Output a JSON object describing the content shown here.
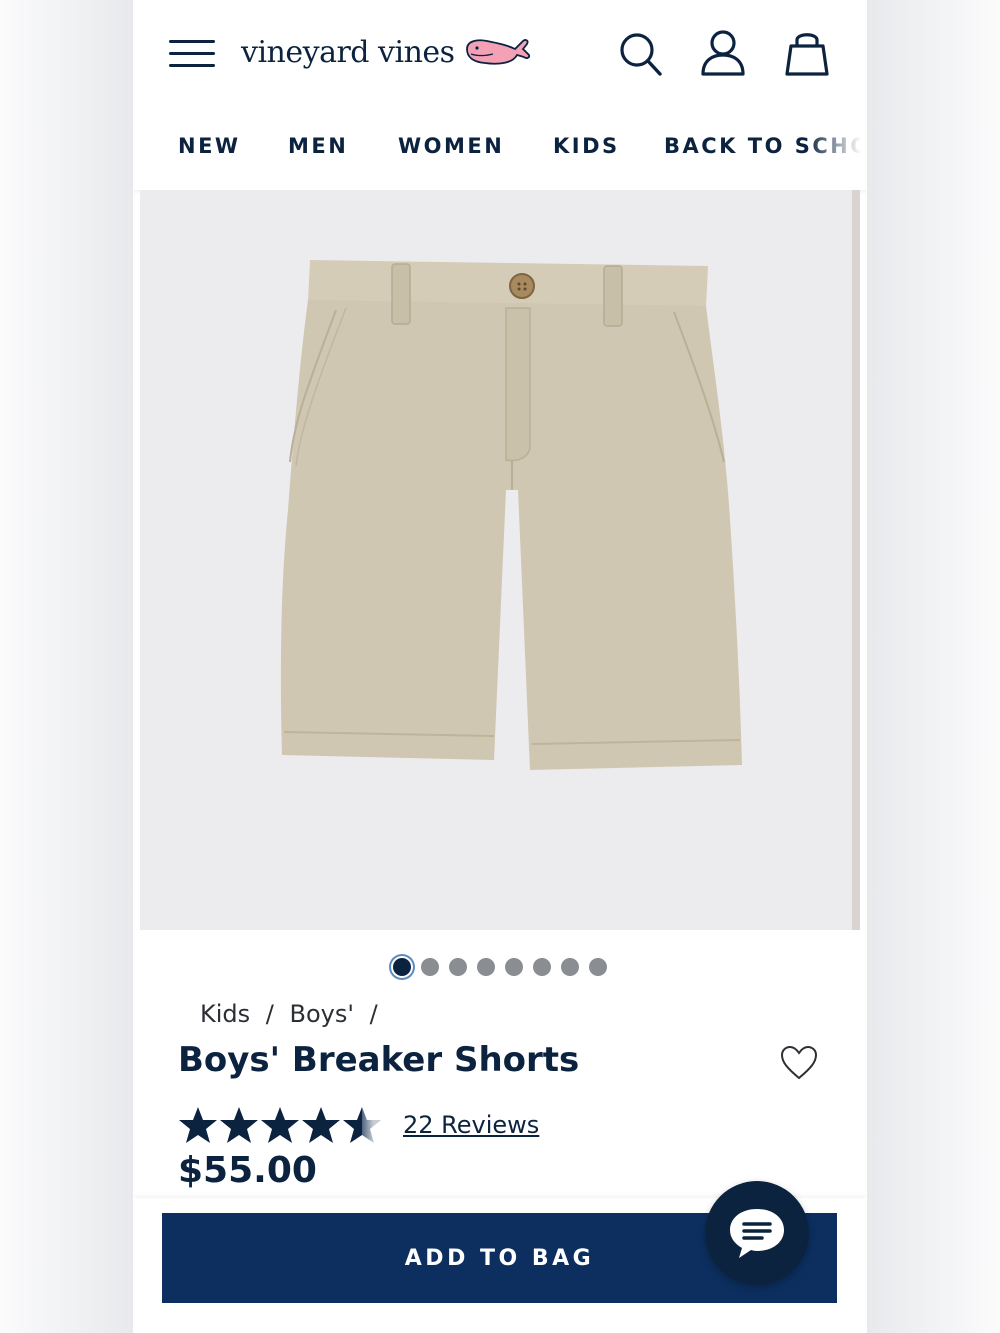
{
  "header": {
    "logo_text": "vineyard vines",
    "icons": [
      "menu-icon",
      "whale-logo-icon",
      "search-icon",
      "account-icon",
      "bag-icon"
    ]
  },
  "nav": {
    "items": [
      "NEW",
      "MEN",
      "WOMEN",
      "KIDS",
      "BACK TO SCHO"
    ]
  },
  "gallery": {
    "total_images": 8,
    "active_index": 0
  },
  "breadcrumb": {
    "items": [
      "Kids",
      "Boys'"
    ],
    "separator": "/"
  },
  "product": {
    "title": "Boys' Breaker Shorts",
    "rating": 4.5,
    "rating_max": 5,
    "reviews_label": "22 Reviews",
    "price": "$55.00"
  },
  "actions": {
    "add_to_bag_label": "ADD TO BAG"
  },
  "colors": {
    "brand_navy": "#0c2340",
    "button_navy": "#0c2f5f",
    "whale_pink": "#f4a0b5",
    "image_bg": "#ececee",
    "shorts_khaki": "#d1c9b4"
  }
}
